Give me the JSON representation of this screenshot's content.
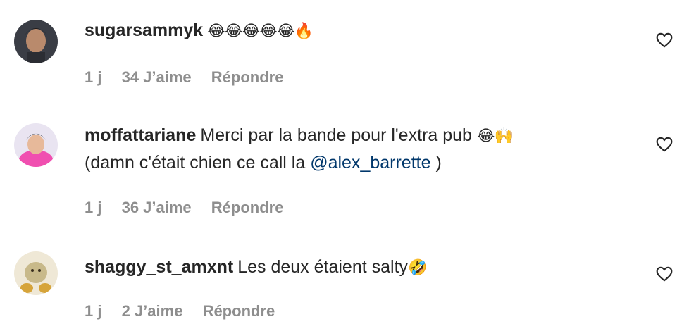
{
  "comments": [
    {
      "username": "sugarsammyk",
      "text_before": "",
      "emoji": "😂😂😂😂😂🔥",
      "mention": "",
      "text_after": "",
      "line2": "",
      "time": "1 j",
      "likes": "34 J’aime",
      "reply": "Répondre",
      "avatar_color": "#3a3d45"
    },
    {
      "username": "moffattariane",
      "text_before": "Merci par la bande pour l'extra pub ",
      "emoji": "😂🙌",
      "line2": "(damn c'était chien ce call la ",
      "mention": "@alex_barrette",
      "text_after": " )",
      "time": "1 j",
      "likes": "36 J’aime",
      "reply": "Répondre",
      "avatar_color": "#f04fb0"
    },
    {
      "username": "shaggy_st_amxnt",
      "text_before": "Les deux étaient salty",
      "emoji": "🤣",
      "mention": "",
      "text_after": "",
      "line2": "",
      "time": "1 j",
      "likes": "2 J’aime",
      "reply": "Répondre",
      "avatar_color": "#c8b98a"
    }
  ],
  "colors": {
    "text": "#262626",
    "meta": "#8e8e8e",
    "mention": "#00376b"
  },
  "icons": {
    "like": "heart-outline-icon"
  }
}
